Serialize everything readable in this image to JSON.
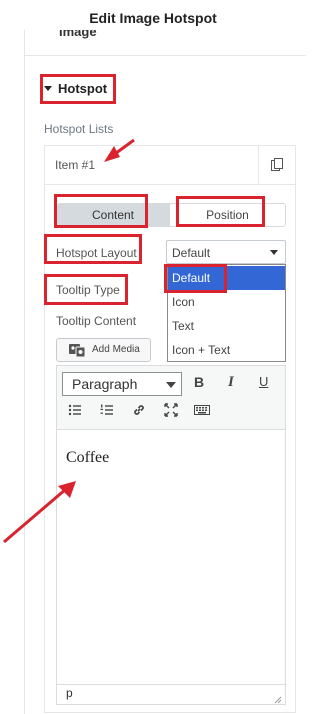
{
  "header": {
    "title": "Edit Image Hotspot",
    "prev_section_label": "Image"
  },
  "section": {
    "title": "Hotspot"
  },
  "repeater": {
    "label": "Hotspot Lists",
    "item_title": "Item #1",
    "tabs": {
      "content": "Content",
      "position": "Position"
    }
  },
  "layout_control": {
    "label": "Hotspot Layout",
    "value": "Default",
    "options": [
      "Default",
      "Icon",
      "Text",
      "Icon + Text"
    ]
  },
  "tooltip": {
    "type_label": "Tooltip Type",
    "content_label": "Tooltip Content",
    "add_media": "Add Media"
  },
  "editor": {
    "format_value": "Paragraph",
    "bold": "B",
    "italic": "I",
    "underline": "U",
    "body_text": "Coffee",
    "status_path": "p"
  },
  "colors": {
    "highlight_red": "#d9232e",
    "selected_option": "#3367d6",
    "tab_active": "#d5dadf"
  },
  "icons": [
    "copy-icon",
    "media-icon",
    "bullet-list-icon",
    "numbered-list-icon",
    "link-icon",
    "fullscreen-icon",
    "keyboard-icon",
    "resize-handle-icon"
  ]
}
